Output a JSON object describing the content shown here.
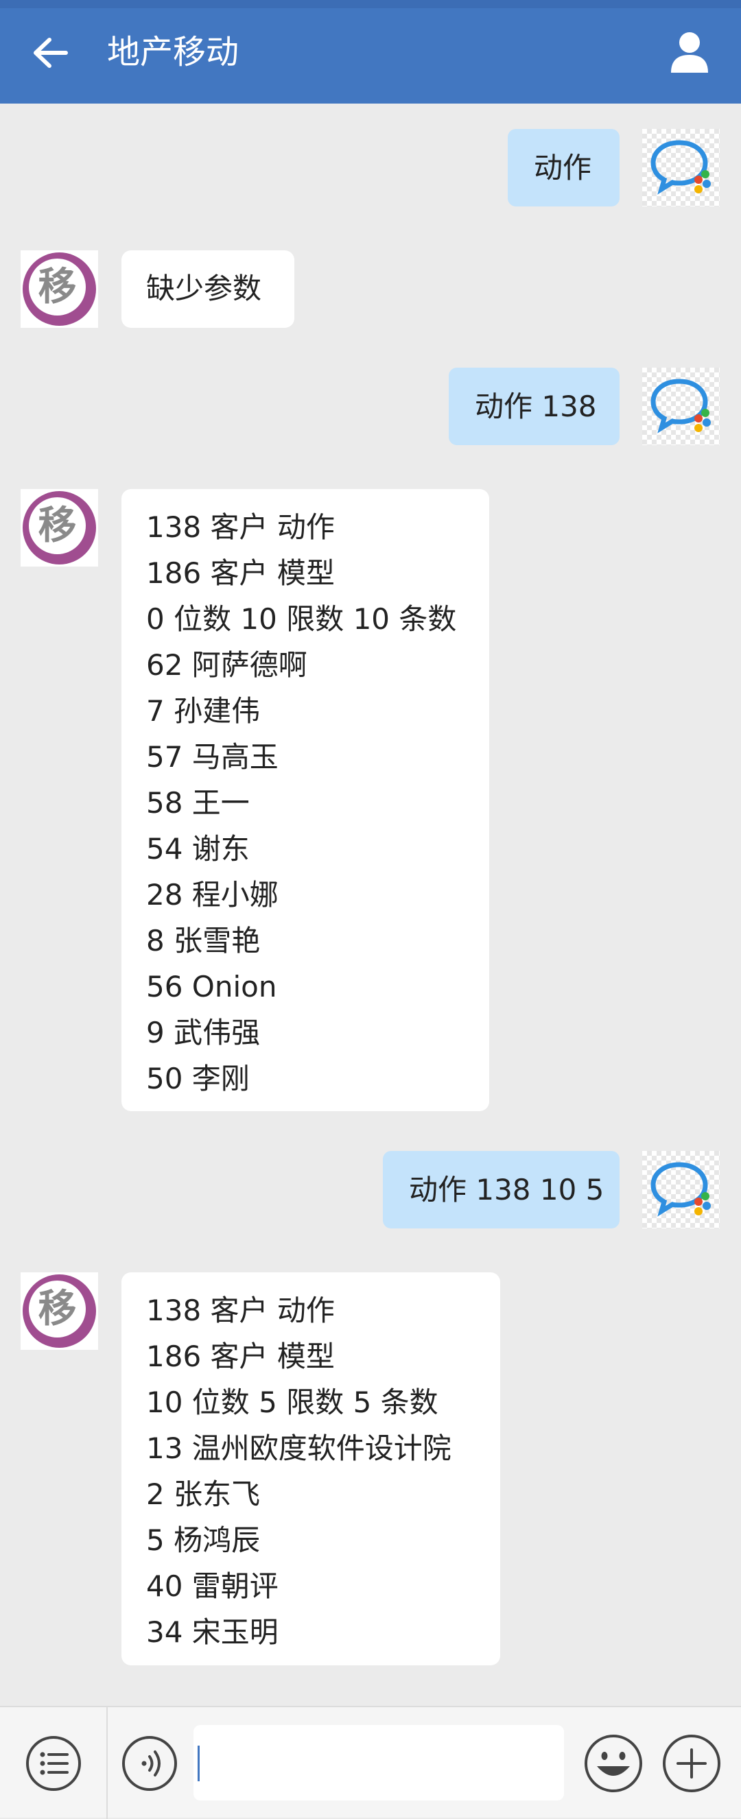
{
  "header": {
    "title": "地产移动"
  },
  "bot_avatar_char": "移",
  "messages": [
    {
      "from": "me",
      "text": "动作"
    },
    {
      "from": "bot",
      "lines": [
        "缺少参数"
      ]
    },
    {
      "from": "me",
      "text": "动作 138"
    },
    {
      "from": "bot",
      "lines": [
        "138 客户 动作",
        "186 客户 模型",
        "0 位数 10 限数 10 条数",
        "62 阿萨德啊",
        "7 孙建伟",
        "57 马高玉",
        "58 王一",
        "54 谢东",
        "28 程小娜",
        "8 张雪艳",
        "56 Onion",
        "9 武伟强",
        "50 李刚"
      ]
    },
    {
      "from": "me",
      "text": "动作 138 10 5"
    },
    {
      "from": "bot",
      "lines": [
        "138 客户 动作",
        "186 客户 模型",
        "10 位数 5 限数 5 条数",
        "13 温州欧度软件设计院",
        "2 张东飞",
        "5 杨鸿辰",
        "40 雷朝评",
        "34 宋玉明"
      ]
    }
  ],
  "input": {
    "value": ""
  },
  "icons": {
    "back": "arrow-left-icon",
    "user": "user-icon",
    "menu": "list-menu-icon",
    "voice": "voice-icon",
    "emoji": "emoji-icon",
    "plus": "plus-icon"
  },
  "colors": {
    "header": "#4277c1",
    "bubble_me": "#c4e3fb",
    "bubble_bot": "#ffffff",
    "background": "#ebebeb",
    "avatar_ring": "#a04d90"
  }
}
